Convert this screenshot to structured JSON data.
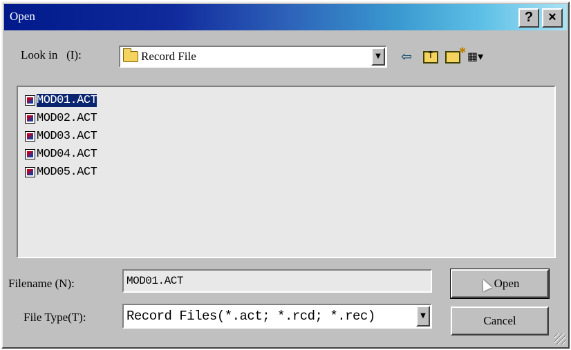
{
  "window": {
    "title": "Open",
    "help_glyph": "?",
    "close_glyph": "×"
  },
  "look_in": {
    "label": "Look in",
    "accel": "(I):",
    "value": "Record File",
    "dropdown_arrow": "▼"
  },
  "toolbar": {
    "icons": [
      "back-arrow-icon",
      "up-folder-icon",
      "new-folder-icon",
      "view-menu-icon"
    ],
    "back_glyph": "⇦",
    "view_glyph": "▦▾"
  },
  "files": [
    {
      "name": "MOD01.ACT",
      "selected": true
    },
    {
      "name": "MOD02.ACT",
      "selected": false
    },
    {
      "name": "MOD03.ACT",
      "selected": false
    },
    {
      "name": "MOD04.ACT",
      "selected": false
    },
    {
      "name": "MOD05.ACT",
      "selected": false
    }
  ],
  "filename": {
    "label": "Filename",
    "accel": "(N):",
    "value": "MOD01.ACT"
  },
  "file_type": {
    "label": "File Type",
    "accel": "(T):",
    "value": "Record Files(*.act; *.rcd; *.rec)",
    "dropdown_arrow": "▼"
  },
  "buttons": {
    "open": "Open",
    "cancel": "Cancel"
  },
  "colors": {
    "title_bar_start": "#001a8c",
    "title_bar_end": "#a9e2f4",
    "selection": "#0a2470",
    "face": "#c0c0c0"
  }
}
